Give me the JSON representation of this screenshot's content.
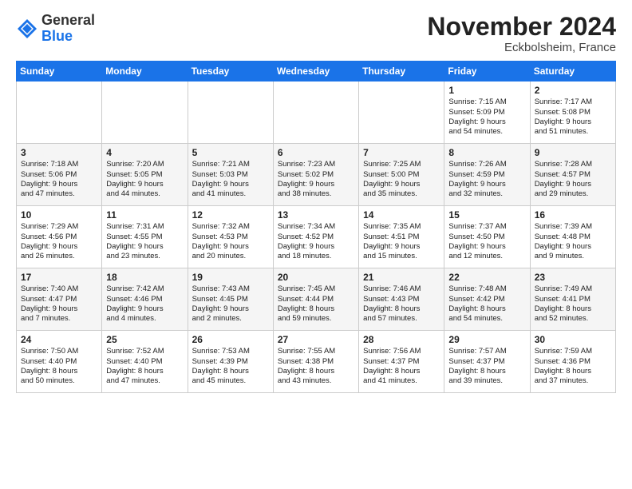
{
  "header": {
    "logo_general": "General",
    "logo_blue": "Blue",
    "month_title": "November 2024",
    "location": "Eckbolsheim, France"
  },
  "weekdays": [
    "Sunday",
    "Monday",
    "Tuesday",
    "Wednesday",
    "Thursday",
    "Friday",
    "Saturday"
  ],
  "weeks": [
    [
      {
        "day": "",
        "info": ""
      },
      {
        "day": "",
        "info": ""
      },
      {
        "day": "",
        "info": ""
      },
      {
        "day": "",
        "info": ""
      },
      {
        "day": "",
        "info": ""
      },
      {
        "day": "1",
        "info": "Sunrise: 7:15 AM\nSunset: 5:09 PM\nDaylight: 9 hours\nand 54 minutes."
      },
      {
        "day": "2",
        "info": "Sunrise: 7:17 AM\nSunset: 5:08 PM\nDaylight: 9 hours\nand 51 minutes."
      }
    ],
    [
      {
        "day": "3",
        "info": "Sunrise: 7:18 AM\nSunset: 5:06 PM\nDaylight: 9 hours\nand 47 minutes."
      },
      {
        "day": "4",
        "info": "Sunrise: 7:20 AM\nSunset: 5:05 PM\nDaylight: 9 hours\nand 44 minutes."
      },
      {
        "day": "5",
        "info": "Sunrise: 7:21 AM\nSunset: 5:03 PM\nDaylight: 9 hours\nand 41 minutes."
      },
      {
        "day": "6",
        "info": "Sunrise: 7:23 AM\nSunset: 5:02 PM\nDaylight: 9 hours\nand 38 minutes."
      },
      {
        "day": "7",
        "info": "Sunrise: 7:25 AM\nSunset: 5:00 PM\nDaylight: 9 hours\nand 35 minutes."
      },
      {
        "day": "8",
        "info": "Sunrise: 7:26 AM\nSunset: 4:59 PM\nDaylight: 9 hours\nand 32 minutes."
      },
      {
        "day": "9",
        "info": "Sunrise: 7:28 AM\nSunset: 4:57 PM\nDaylight: 9 hours\nand 29 minutes."
      }
    ],
    [
      {
        "day": "10",
        "info": "Sunrise: 7:29 AM\nSunset: 4:56 PM\nDaylight: 9 hours\nand 26 minutes."
      },
      {
        "day": "11",
        "info": "Sunrise: 7:31 AM\nSunset: 4:55 PM\nDaylight: 9 hours\nand 23 minutes."
      },
      {
        "day": "12",
        "info": "Sunrise: 7:32 AM\nSunset: 4:53 PM\nDaylight: 9 hours\nand 20 minutes."
      },
      {
        "day": "13",
        "info": "Sunrise: 7:34 AM\nSunset: 4:52 PM\nDaylight: 9 hours\nand 18 minutes."
      },
      {
        "day": "14",
        "info": "Sunrise: 7:35 AM\nSunset: 4:51 PM\nDaylight: 9 hours\nand 15 minutes."
      },
      {
        "day": "15",
        "info": "Sunrise: 7:37 AM\nSunset: 4:50 PM\nDaylight: 9 hours\nand 12 minutes."
      },
      {
        "day": "16",
        "info": "Sunrise: 7:39 AM\nSunset: 4:48 PM\nDaylight: 9 hours\nand 9 minutes."
      }
    ],
    [
      {
        "day": "17",
        "info": "Sunrise: 7:40 AM\nSunset: 4:47 PM\nDaylight: 9 hours\nand 7 minutes."
      },
      {
        "day": "18",
        "info": "Sunrise: 7:42 AM\nSunset: 4:46 PM\nDaylight: 9 hours\nand 4 minutes."
      },
      {
        "day": "19",
        "info": "Sunrise: 7:43 AM\nSunset: 4:45 PM\nDaylight: 9 hours\nand 2 minutes."
      },
      {
        "day": "20",
        "info": "Sunrise: 7:45 AM\nSunset: 4:44 PM\nDaylight: 8 hours\nand 59 minutes."
      },
      {
        "day": "21",
        "info": "Sunrise: 7:46 AM\nSunset: 4:43 PM\nDaylight: 8 hours\nand 57 minutes."
      },
      {
        "day": "22",
        "info": "Sunrise: 7:48 AM\nSunset: 4:42 PM\nDaylight: 8 hours\nand 54 minutes."
      },
      {
        "day": "23",
        "info": "Sunrise: 7:49 AM\nSunset: 4:41 PM\nDaylight: 8 hours\nand 52 minutes."
      }
    ],
    [
      {
        "day": "24",
        "info": "Sunrise: 7:50 AM\nSunset: 4:40 PM\nDaylight: 8 hours\nand 50 minutes."
      },
      {
        "day": "25",
        "info": "Sunrise: 7:52 AM\nSunset: 4:40 PM\nDaylight: 8 hours\nand 47 minutes."
      },
      {
        "day": "26",
        "info": "Sunrise: 7:53 AM\nSunset: 4:39 PM\nDaylight: 8 hours\nand 45 minutes."
      },
      {
        "day": "27",
        "info": "Sunrise: 7:55 AM\nSunset: 4:38 PM\nDaylight: 8 hours\nand 43 minutes."
      },
      {
        "day": "28",
        "info": "Sunrise: 7:56 AM\nSunset: 4:37 PM\nDaylight: 8 hours\nand 41 minutes."
      },
      {
        "day": "29",
        "info": "Sunrise: 7:57 AM\nSunset: 4:37 PM\nDaylight: 8 hours\nand 39 minutes."
      },
      {
        "day": "30",
        "info": "Sunrise: 7:59 AM\nSunset: 4:36 PM\nDaylight: 8 hours\nand 37 minutes."
      }
    ]
  ]
}
